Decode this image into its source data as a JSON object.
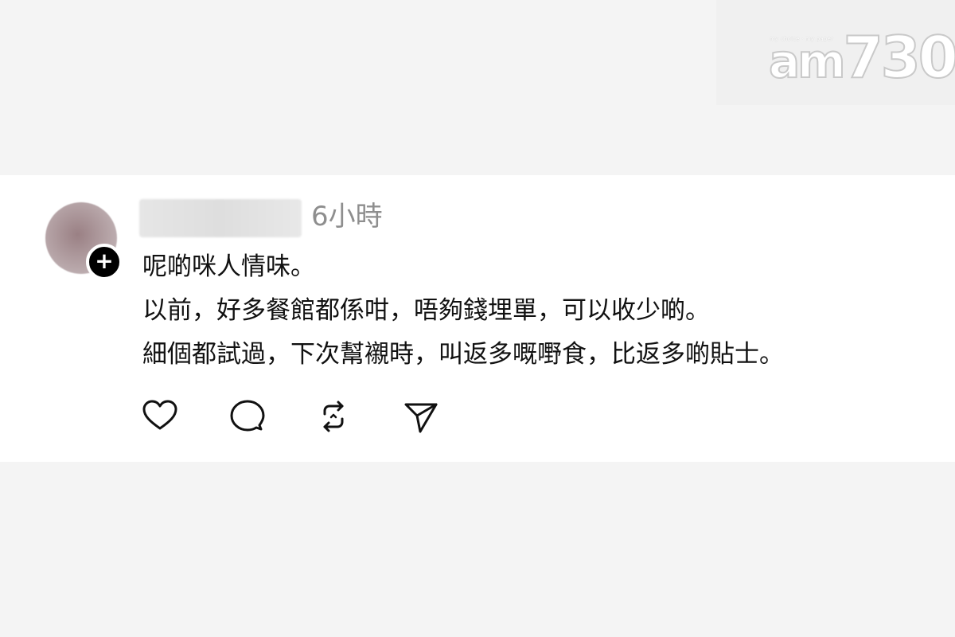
{
  "watermark": {
    "tagline": "my choice · my paper",
    "logo_prefix": "am",
    "logo_number": "730"
  },
  "post": {
    "timestamp": "6小時",
    "lines": [
      "呢啲咪人情味。",
      "以前，好多餐館都係咁，唔夠錢埋單，可以收少啲。",
      "細個都試過，下次幫襯時，叫返多嘅嘢食，比返多啲貼士。"
    ],
    "follow_badge_symbol": "+"
  },
  "actions": {
    "like_icon": "heart-icon",
    "comment_icon": "comment-icon",
    "repost_icon": "repost-icon",
    "share_icon": "send-icon"
  }
}
